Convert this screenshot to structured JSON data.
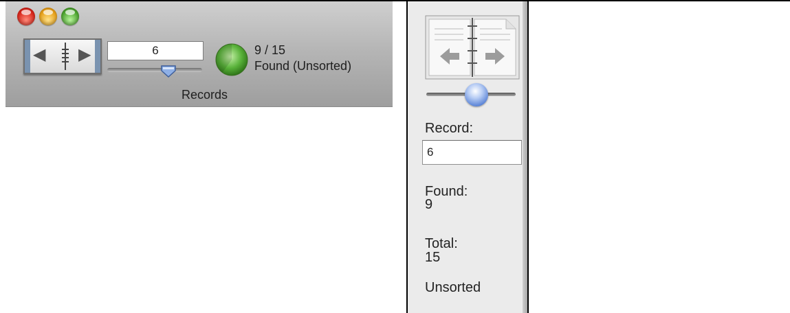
{
  "new_toolbar": {
    "record_value": "6",
    "count_display": "9 / 15",
    "found_status": "Found (Unsorted)",
    "records_label": "Records",
    "found_fraction": 0.6,
    "slider_level": 0.6
  },
  "classic_status": {
    "record_label": "Record:",
    "record_value": "6",
    "found_label": "Found:",
    "found_value": "9",
    "total_label": "Total:",
    "total_value": "15",
    "sort_status": "Unsorted",
    "slider_level": 0.5
  },
  "icons": {
    "book": "book-navigation-icon",
    "pie": "found-pie-icon",
    "window_controls": [
      "close-button",
      "minimize-button",
      "zoom-button"
    ]
  },
  "colors": {
    "toolbar_gradient_top": "#cfcfcf",
    "toolbar_gradient_bottom": "#9e9e9e",
    "pie_green": "#59b23a",
    "classic_bg": "#ebebeb"
  }
}
